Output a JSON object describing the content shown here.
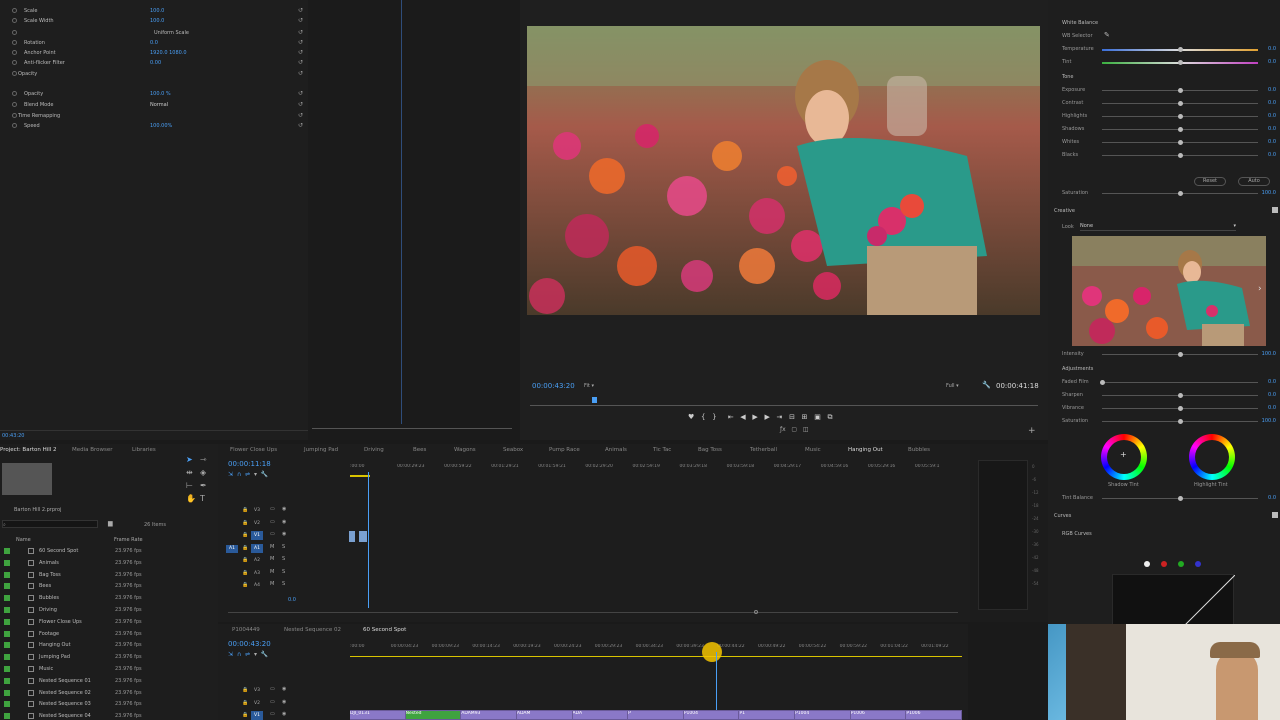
{
  "effect_controls": {
    "rows": [
      {
        "label": "Scale",
        "value": "100.0"
      },
      {
        "label": "Scale Width",
        "value": "100.0"
      },
      {
        "label": "Uniform Scale",
        "value": ""
      },
      {
        "label": "Rotation",
        "value": "0.0"
      },
      {
        "label": "Anchor Point",
        "value": "1920.0   1080.0"
      },
      {
        "label": "Anti-flicker Filter",
        "value": "0.00"
      },
      {
        "label": "Opacity",
        "value": ""
      },
      {
        "label": "Opacity",
        "value": "100.0 %"
      },
      {
        "label": "Blend Mode",
        "value": "Normal"
      },
      {
        "label": "Time Remapping",
        "value": ""
      },
      {
        "label": "Speed",
        "value": "100.00%"
      }
    ],
    "timecode": "00:43:20"
  },
  "program_monitor": {
    "timecode_current": "00:00:43:20",
    "fit_label": "Fit",
    "quality_label": "Full",
    "timecode_duration": "00:00:41:18"
  },
  "lumetri": {
    "wb_header": "White Balance",
    "wb_selector": "WB Selector",
    "sliders_wb": [
      {
        "label": "Temperature",
        "value": "0.0",
        "pos": 0.5
      },
      {
        "label": "Tint",
        "value": "0.0",
        "pos": 0.5
      }
    ],
    "tone_header": "Tone",
    "sliders_tone": [
      {
        "label": "Exposure",
        "value": "0.0",
        "pos": 0.5
      },
      {
        "label": "Contrast",
        "value": "0.0",
        "pos": 0.5
      },
      {
        "label": "Highlights",
        "value": "0.0",
        "pos": 0.5
      },
      {
        "label": "Shadows",
        "value": "0.0",
        "pos": 0.5
      },
      {
        "label": "Whites",
        "value": "0.0",
        "pos": 0.5
      },
      {
        "label": "Blacks",
        "value": "0.0",
        "pos": 0.5
      }
    ],
    "reset_label": "Reset",
    "auto_label": "Auto",
    "saturation_label": "Saturation",
    "saturation_value": "100.0",
    "creative_header": "Creative",
    "look_label": "Look",
    "look_value": "None",
    "intensity_label": "Intensity",
    "intensity_value": "100.0",
    "adjustments_header": "Adjustments",
    "sliders_adj": [
      {
        "label": "Faded Film",
        "value": "0.0",
        "pos": 0.0
      },
      {
        "label": "Sharpen",
        "value": "0.0",
        "pos": 0.5
      },
      {
        "label": "Vibrance",
        "value": "0.0",
        "pos": 0.5
      },
      {
        "label": "Saturation",
        "value": "100.0",
        "pos": 0.5
      }
    ],
    "shadow_tint": "Shadow Tint",
    "highlight_tint": "Highlight Tint",
    "tint_balance": "Tint Balance",
    "tint_balance_value": "0.0",
    "curves_header": "Curves",
    "rgb_curves": "RGB Curves"
  },
  "project": {
    "tabs": [
      "Project: Barton Hill 2",
      "Media Browser",
      "Libraries"
    ],
    "filename": "Barton Hill 2.prproj",
    "item_count": "26 Items",
    "col_name": "Name",
    "col_rate": "Frame Rate",
    "items": [
      {
        "name": "60 Second Spot",
        "rate": "23.976 fps"
      },
      {
        "name": "Animals",
        "rate": "23.976 fps"
      },
      {
        "name": "Bag Toss",
        "rate": "23.976 fps"
      },
      {
        "name": "Bees",
        "rate": "23.976 fps"
      },
      {
        "name": "Bubbles",
        "rate": "23.976 fps"
      },
      {
        "name": "Driving",
        "rate": "23.976 fps"
      },
      {
        "name": "Flower Close Ups",
        "rate": "23.976 fps"
      },
      {
        "name": "Footage",
        "rate": "23.976 fps"
      },
      {
        "name": "Hanging Out",
        "rate": "23.976 fps"
      },
      {
        "name": "Jumping Pad",
        "rate": "23.976 fps"
      },
      {
        "name": "Music",
        "rate": "23.976 fps"
      },
      {
        "name": "Nested Sequence 01",
        "rate": "23.976 fps"
      },
      {
        "name": "Nested Sequence 02",
        "rate": "23.976 fps"
      },
      {
        "name": "Nested Sequence 03",
        "rate": "23.976 fps"
      },
      {
        "name": "Nested Sequence 04",
        "rate": "23.976 fps"
      }
    ]
  },
  "timeline_top": {
    "tabs": [
      "Flower Close Ups",
      "Jumping Pad",
      "Driving",
      "Bees",
      "Wagons",
      "Seabox",
      "Pump Race",
      "Animals",
      "Tic Tac",
      "Bag Toss",
      "Tetherball",
      "Music",
      "Hanging Out",
      "Bubbles"
    ],
    "active_tab": "Hanging Out",
    "timecode": "00:00:11:18",
    "ruler": [
      ":00:00",
      "00:00:29:23",
      "00:00:59:22",
      "00:01:29:21",
      "00:01:59:21",
      "00:02:29:20",
      "00:02:59:19",
      "00:03:29:18",
      "00:03:59:18",
      "00:04:29:17",
      "00:04:59:16",
      "00:05:29:16",
      "00:05:59:1"
    ],
    "tracks": [
      "V3",
      "V2",
      "V1",
      "A1",
      "A2",
      "A3",
      "A4"
    ],
    "master_value": "0.0"
  },
  "timeline_bottom": {
    "tabs": [
      "P1004449",
      "Nested Sequence 02",
      "60 Second Spot"
    ],
    "active_tab": "60 Second Spot",
    "timecode": "00:00:43:20",
    "ruler": [
      ":00:00",
      "00:00:04:23",
      "00:00:09:23",
      "00:00:14:23",
      "00:00:19:23",
      "00:00:24:23",
      "00:00:29:23",
      "00:00:34:23",
      "00:00:39:23",
      "00:00:44:22",
      "00:00:49:22",
      "00:00:54:22",
      "00:00:59:22",
      "00:01:04:22",
      "00:01:09:22"
    ],
    "tracks": [
      "V3",
      "V2",
      "V1"
    ],
    "clips": [
      "DJI_0131",
      "Nested",
      "ADAM93",
      "ADAM",
      "ADA",
      "P",
      "P1004",
      "P1",
      "P1004",
      "P1006",
      "P1006"
    ]
  },
  "colors": {
    "accent": "#4a9ff5",
    "playhead": "#f5c400",
    "label_green": "#3fa33f"
  }
}
